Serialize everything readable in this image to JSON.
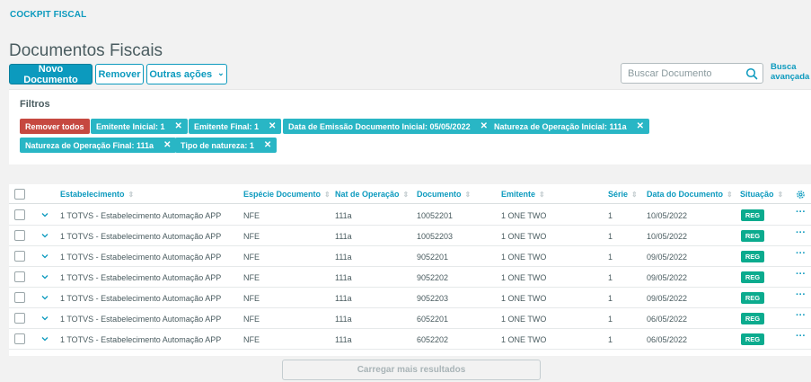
{
  "app": {
    "title": "COCKPIT FISCAL"
  },
  "page": {
    "title": "Documentos Fiscais"
  },
  "toolbar": {
    "new_label": "Novo Documento",
    "remove_label": "Remover",
    "more_label": "Outras ações"
  },
  "search": {
    "placeholder": "Buscar Documento",
    "value": "",
    "advanced_label": "Busca avançada"
  },
  "filters": {
    "title": "Filtros",
    "clear_label": "Remover todos",
    "tags": [
      "Emitente Inicial: 1",
      "Emitente Final: 1",
      "Data de Emissão Documento Inicial: 05/05/2022",
      "Natureza de Operação Inicial: 111a",
      "Natureza de Operação Final: 111a",
      "Tipo de natureza: 1"
    ]
  },
  "table": {
    "columns": [
      "Estabelecimento",
      "Espécie Documento",
      "Nat de Operação",
      "Documento",
      "Emitente",
      "Série",
      "Data do Documento",
      "Situação"
    ],
    "rows": [
      {
        "estab": "1 TOTVS - Estabelecimento Automação APP",
        "especie": "NFE",
        "nat": "111a",
        "doc": "10052201",
        "emit": "1 ONE TWO",
        "serie": "1",
        "data": "10/05/2022",
        "situacao": "REG"
      },
      {
        "estab": "1 TOTVS - Estabelecimento Automação APP",
        "especie": "NFE",
        "nat": "111a",
        "doc": "10052203",
        "emit": "1 ONE TWO",
        "serie": "1",
        "data": "10/05/2022",
        "situacao": "REG"
      },
      {
        "estab": "1 TOTVS - Estabelecimento Automação APP",
        "especie": "NFE",
        "nat": "111a",
        "doc": "9052201",
        "emit": "1 ONE TWO",
        "serie": "1",
        "data": "09/05/2022",
        "situacao": "REG"
      },
      {
        "estab": "1 TOTVS - Estabelecimento Automação APP",
        "especie": "NFE",
        "nat": "111a",
        "doc": "9052202",
        "emit": "1 ONE TWO",
        "serie": "1",
        "data": "09/05/2022",
        "situacao": "REG"
      },
      {
        "estab": "1 TOTVS - Estabelecimento Automação APP",
        "especie": "NFE",
        "nat": "111a",
        "doc": "9052203",
        "emit": "1 ONE TWO",
        "serie": "1",
        "data": "09/05/2022",
        "situacao": "REG"
      },
      {
        "estab": "1 TOTVS - Estabelecimento Automação APP",
        "especie": "NFE",
        "nat": "111a",
        "doc": "6052201",
        "emit": "1 ONE TWO",
        "serie": "1",
        "data": "06/05/2022",
        "situacao": "REG"
      },
      {
        "estab": "1 TOTVS - Estabelecimento Automação APP",
        "especie": "NFE",
        "nat": "111a",
        "doc": "6052202",
        "emit": "1 ONE TWO",
        "serie": "1",
        "data": "06/05/2022",
        "situacao": "REG"
      }
    ],
    "actions_glyph": "···"
  },
  "load_more": {
    "label": "Carregar mais resultados"
  },
  "icons": {
    "search": "search-icon",
    "chevron_down": "chevron-down-icon",
    "close": "close-icon",
    "gear": "gear-icon",
    "more": "more-options-icon"
  },
  "colors": {
    "primary": "#0c9abe",
    "danger": "#c64840",
    "tag": "#29b6c5",
    "status_reg": "#0bab8e"
  }
}
